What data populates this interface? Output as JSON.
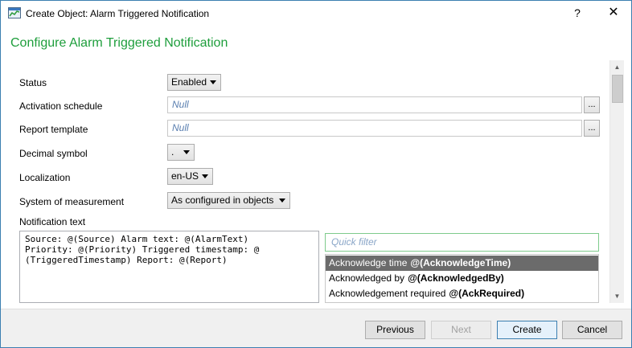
{
  "window": {
    "title": "Create Object: Alarm Triggered Notification",
    "help_glyph": "?",
    "close_glyph": "✕"
  },
  "heading": "Configure Alarm Triggered Notification",
  "form": {
    "status": {
      "label": "Status",
      "value": "Enabled"
    },
    "activation_schedule": {
      "label": "Activation schedule",
      "placeholder": "Null",
      "browse": "..."
    },
    "report_template": {
      "label": "Report template",
      "placeholder": "Null",
      "browse": "..."
    },
    "decimal_symbol": {
      "label": "Decimal symbol",
      "value": "."
    },
    "localization": {
      "label": "Localization",
      "value": "en-US"
    },
    "system_of_measurement": {
      "label": "System of measurement",
      "value": "As configured in objects"
    },
    "notification_text": {
      "label": "Notification text",
      "lines": [
        "Source: @(Source) Alarm text: @(AlarmText)",
        "Priority: @(Priority) Triggered timestamp: @",
        "(TriggeredTimestamp) Report: @(Report)"
      ]
    }
  },
  "quick_filter": {
    "placeholder": "Quick filter"
  },
  "variables": [
    {
      "name": "Acknowledge time",
      "token": "@(AcknowledgeTime)",
      "selected": true
    },
    {
      "name": "Acknowledged by",
      "token": "@(AcknowledgedBy)",
      "selected": false
    },
    {
      "name": "Acknowledgement required",
      "token": "@(AckRequired)",
      "selected": false
    }
  ],
  "footer": {
    "previous": "Previous",
    "next": "Next",
    "create": "Create",
    "cancel": "Cancel"
  },
  "icons": {
    "app": "app-window-icon",
    "scroll_up": "▲",
    "scroll_down": "▼"
  }
}
